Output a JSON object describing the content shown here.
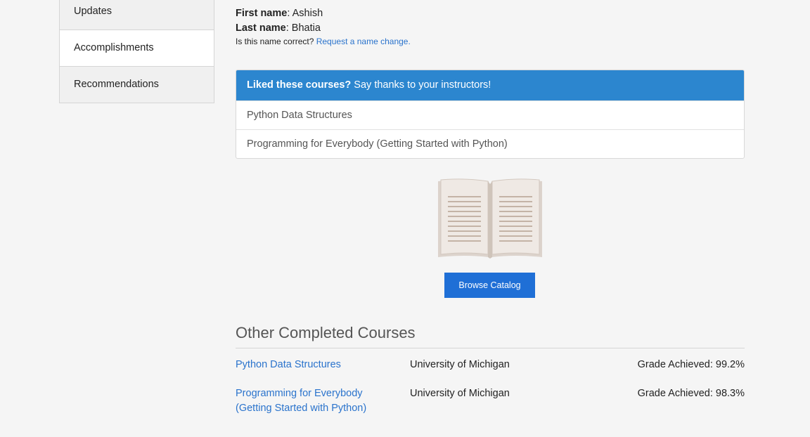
{
  "sidebar": {
    "items": [
      {
        "label": "Updates",
        "active": false
      },
      {
        "label": "Accomplishments",
        "active": true
      },
      {
        "label": "Recommendations",
        "active": false
      }
    ]
  },
  "profile": {
    "first_name_label": "First name",
    "first_name": "Ashish",
    "last_name_label": "Last name",
    "last_name": "Bhatia",
    "name_question": "Is this name correct?",
    "name_change_link": "Request a name change."
  },
  "thanks": {
    "heading_bold": "Liked these courses?",
    "heading_rest": " Say thanks to your instructors!",
    "courses": [
      "Python Data Structures",
      "Programming for Everybody (Getting Started with Python)"
    ],
    "header_color": "#2c86cf"
  },
  "catalog": {
    "icon": "open-book-icon",
    "button_label": "Browse Catalog",
    "button_color": "#1f6fd6"
  },
  "other_courses": {
    "title": "Other Completed Courses",
    "rows": [
      {
        "course": "Python Data Structures",
        "university": "University of Michigan",
        "grade": "Grade Achieved: 99.2%"
      },
      {
        "course": "Programming for Everybody (Getting Started with Python)",
        "university": "University of Michigan",
        "grade": "Grade Achieved: 98.3%"
      }
    ],
    "link_color": "#2a73cc"
  }
}
